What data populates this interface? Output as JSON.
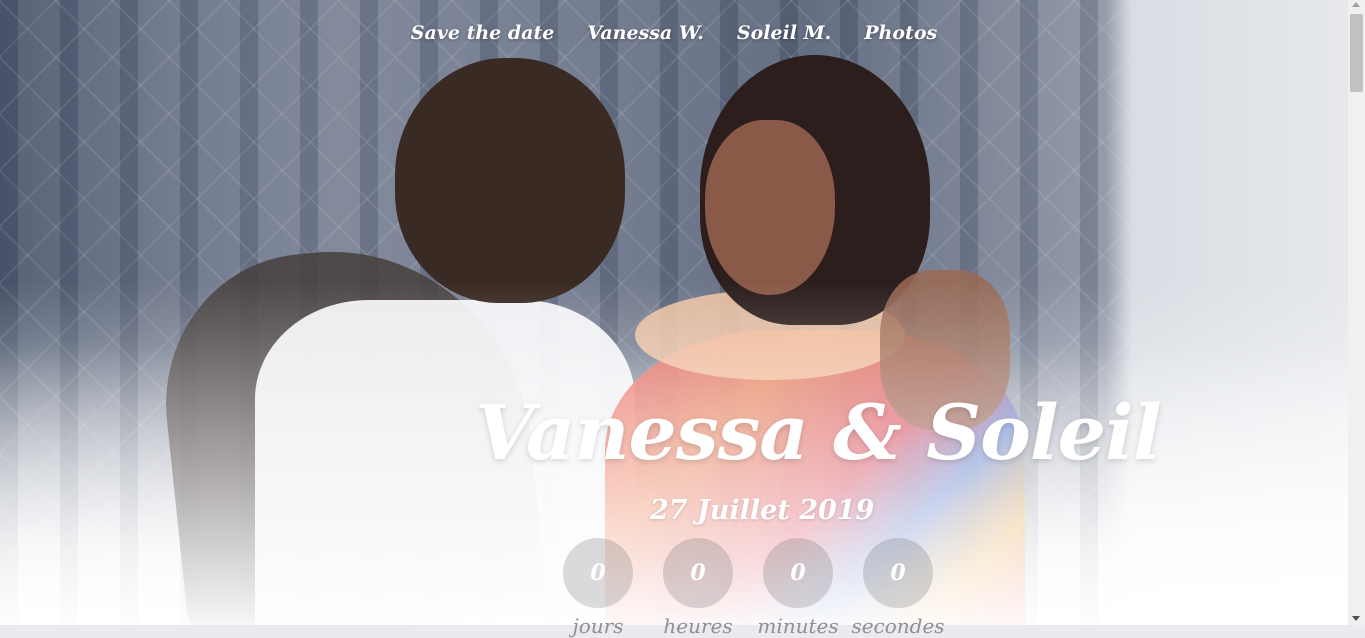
{
  "nav": {
    "items": [
      {
        "label": "Save the date"
      },
      {
        "label": "Vanessa W."
      },
      {
        "label": "Soleil M."
      },
      {
        "label": "Photos"
      }
    ]
  },
  "hero": {
    "title": "Vanessa & Soleil",
    "date": "27 Juillet 2019"
  },
  "countdown": [
    {
      "value": "0",
      "label": "jours"
    },
    {
      "value": "0",
      "label": "heures"
    },
    {
      "value": "0",
      "label": "minutes"
    },
    {
      "value": "0",
      "label": "secondes"
    }
  ],
  "colors": {
    "text": "#ffffff",
    "countdown_label": "#8f8f94"
  }
}
